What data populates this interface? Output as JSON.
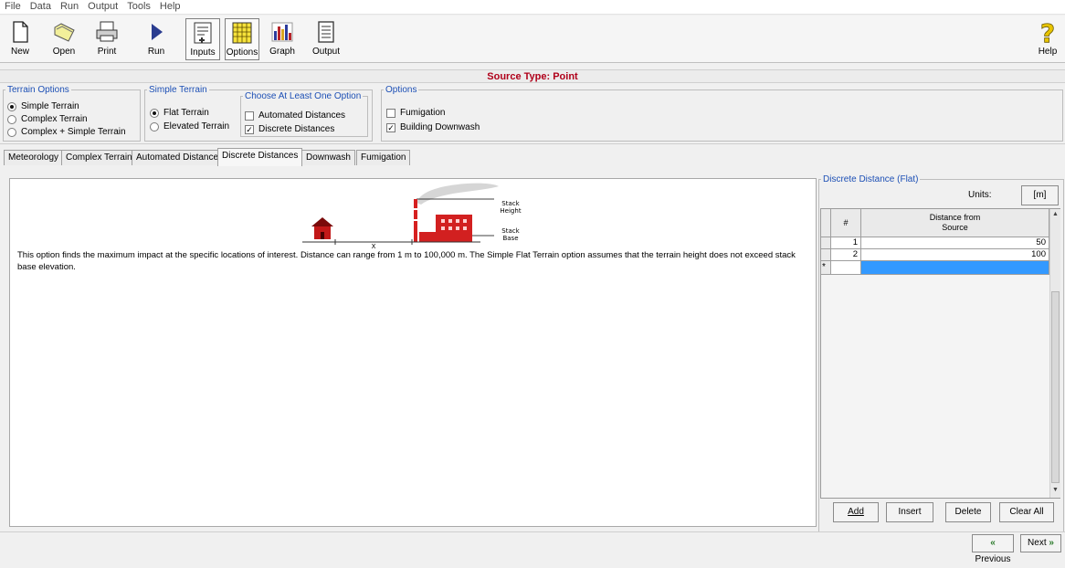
{
  "menu": [
    "File",
    "Data",
    "Run",
    "Output",
    "Tools",
    "Help"
  ],
  "toolbar": {
    "new": "New",
    "open": "Open",
    "print": "Print",
    "run": "Run",
    "inputs": "Inputs",
    "options": "Options",
    "graph": "Graph",
    "output": "Output",
    "help": "Help"
  },
  "source_type": "Source Type: Point",
  "terrain_options": {
    "legend": "Terrain Options",
    "items": [
      "Simple Terrain",
      "Complex Terrain",
      "Complex + Simple Terrain"
    ],
    "selected": "Simple Terrain"
  },
  "simple_terrain": {
    "legend": "Simple Terrain",
    "items": [
      "Flat Terrain",
      "Elevated Terrain"
    ],
    "selected": "Flat Terrain"
  },
  "choose_option": {
    "legend": "Choose At Least One Option",
    "automated": "Automated Distances",
    "automated_checked": false,
    "discrete": "Discrete Distances",
    "discrete_checked": true
  },
  "options": {
    "legend": "Options",
    "fumigation": "Fumigation",
    "fumigation_checked": false,
    "downwash": "Building Downwash",
    "downwash_checked": true
  },
  "tabs": [
    "Meteorology",
    "Complex Terrain",
    "Automated Distances",
    "Discrete Distances",
    "Downwash",
    "Fumigation"
  ],
  "active_tab": "Discrete Distances",
  "diagram": {
    "stack_height": "Stack\nHeight",
    "stack_base": "Stack\nBase",
    "x_label": "X"
  },
  "description": "This option finds the maximum impact at the specific locations of interest. Distance can range from 1 m to 100,000 m.  The Simple Flat Terrain option assumes that the terrain height does not exceed stack base elevation.",
  "discrete_panel": {
    "legend": "Discrete Distance (Flat)",
    "units_label": "Units:",
    "units_value": "[m]",
    "col_num": "#",
    "col_distance": "Distance from\nSource",
    "rows": [
      {
        "num": "1",
        "distance": "50"
      },
      {
        "num": "2",
        "distance": "100"
      }
    ],
    "new_row_marker": "*",
    "buttons": {
      "add": "Add",
      "insert": "Insert",
      "delete": "Delete",
      "clear": "Clear All"
    }
  },
  "nav": {
    "previous": "Previous",
    "next": "Next"
  },
  "colors": {
    "accent_red": "#b0001a",
    "legend_blue": "#1c4fb5",
    "selected_row": "#3399ff"
  }
}
